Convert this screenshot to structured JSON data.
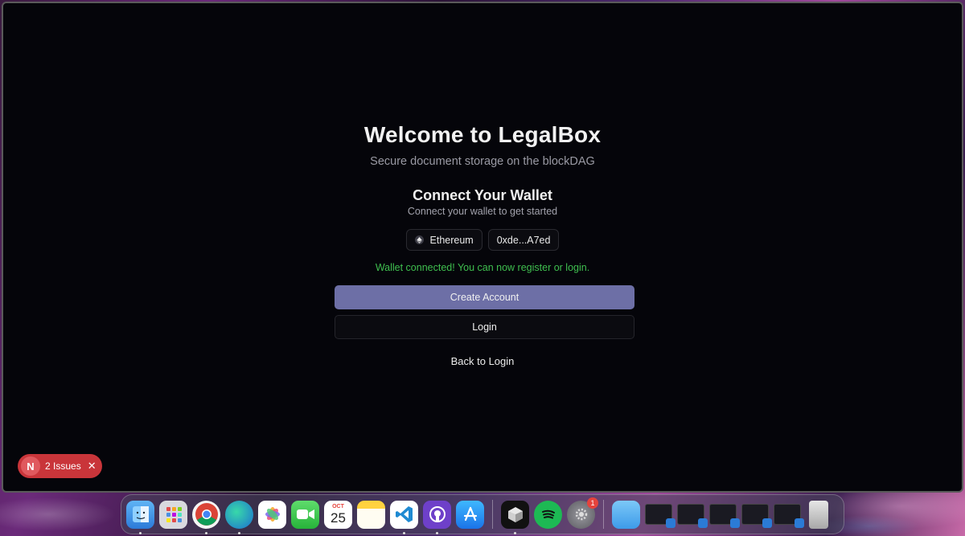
{
  "app": {
    "title": "Welcome to LegalBox",
    "subtitle": "Secure document storage on the blockDAG"
  },
  "wallet": {
    "title": "Connect Your Wallet",
    "subtitle": "Connect your wallet to get started",
    "network_label": "Ethereum",
    "address_label": "0xde...A7ed",
    "status_text": "Wallet connected! You can now register or login.",
    "status_color": "#3fbf4f"
  },
  "actions": {
    "create_account": "Create Account",
    "login": "Login",
    "back_to_login": "Back to Login"
  },
  "issues_toast": {
    "logo_letter": "N",
    "label": "2 Issues",
    "close": "✕"
  },
  "dock": {
    "calendar_month": "OCT",
    "calendar_day": "25",
    "settings_badge": "1"
  },
  "colors": {
    "primary_button": "#6d6fa6",
    "background": "#05050a",
    "issues_badge": "#c9353a"
  }
}
